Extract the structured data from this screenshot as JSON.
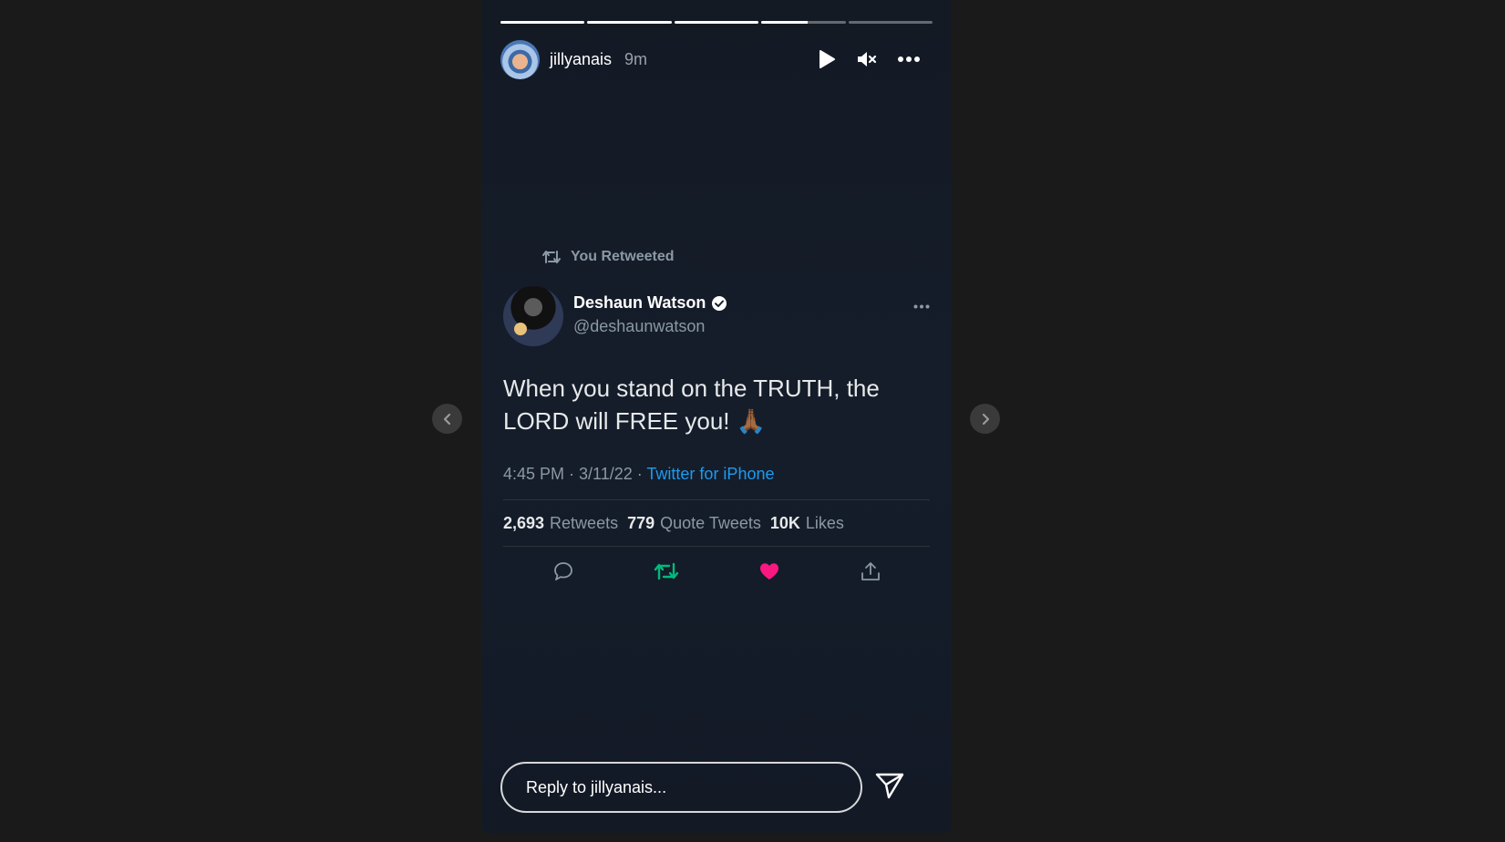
{
  "story": {
    "progress": [
      1,
      1,
      1,
      0.55,
      0
    ],
    "username": "jillyanais",
    "time": "9m",
    "controls": {
      "play_icon": "play-icon",
      "mute_icon": "mute-icon",
      "more_icon": "more-icon"
    }
  },
  "tweet": {
    "retweet_label": "You Retweeted",
    "author_name": "Deshaun Watson",
    "handle": "@deshaunwatson",
    "text": "When you stand on the TRUTH, the LORD will FREE you! 🙏🏾",
    "timestamp": "4:45 PM · 3/11/22 · ",
    "source": "Twitter for iPhone",
    "stats": {
      "retweets_num": "2,693",
      "retweets_label": "Retweets",
      "quotes_num": "779",
      "quotes_label": "Quote Tweets",
      "likes_num": "10K",
      "likes_label": "Likes"
    },
    "colors": {
      "retweet_active": "#00ba7c",
      "like_active": "#f91880",
      "link": "#1d9bf0"
    }
  },
  "reply": {
    "placeholder": "Reply to jillyanais..."
  }
}
